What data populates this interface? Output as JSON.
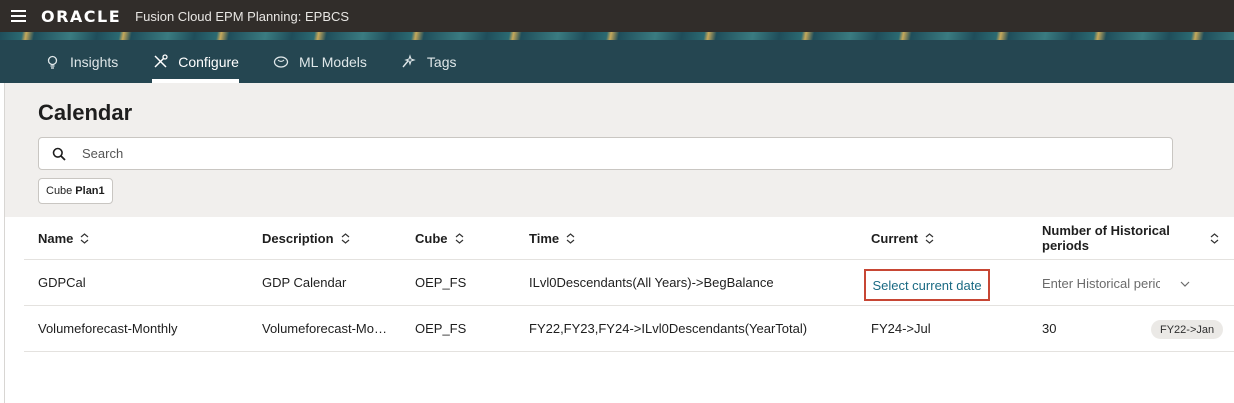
{
  "header": {
    "logo_text": "ORACLE",
    "app_title": "Fusion Cloud EPM Planning: EPBCS"
  },
  "nav": {
    "tabs": [
      {
        "label": "Insights",
        "icon": "lightbulb-icon",
        "active": false
      },
      {
        "label": "Configure",
        "icon": "tools-icon",
        "active": true
      },
      {
        "label": "ML Models",
        "icon": "brain-icon",
        "active": false
      },
      {
        "label": "Tags",
        "icon": "sparkle-tag-icon",
        "active": false
      }
    ]
  },
  "page": {
    "title": "Calendar",
    "search_placeholder": "Search",
    "filter_chip": {
      "label": "Cube",
      "value": "Plan1"
    }
  },
  "table": {
    "columns": [
      "Name",
      "Description",
      "Cube",
      "Time",
      "Current",
      "Number of Historical periods"
    ],
    "rows": [
      {
        "name": "GDPCal",
        "description": "GDP Calendar",
        "cube": "OEP_FS",
        "time": "ILvl0Descendants(All Years)->BegBalance",
        "current_action": "Select current date",
        "historical_placeholder": "Enter Historical peric"
      },
      {
        "name": "Volumeforecast-Monthly",
        "description": "Volumeforecast-Mo…",
        "cube": "OEP_FS",
        "time": "FY22,FY23,FY24->ILvl0Descendants(YearTotal)",
        "current": "FY24->Jul",
        "historical_periods": "30",
        "historical_start": "FY22->Jan"
      }
    ]
  },
  "colors": {
    "topbar": "#312d2a",
    "navbar": "#254651",
    "highlight_border": "#c74634",
    "link": "#1a6a83"
  }
}
